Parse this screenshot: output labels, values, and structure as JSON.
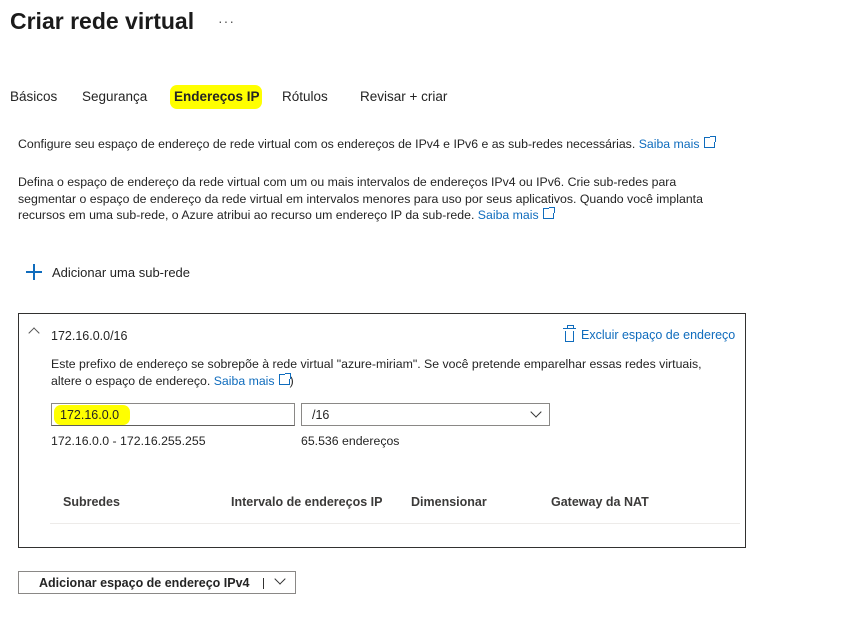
{
  "page": {
    "title": "Criar rede virtual",
    "more": "···"
  },
  "tabs": [
    {
      "label": "Básicos"
    },
    {
      "label": "Segurança"
    },
    {
      "label": "Endereços IP"
    },
    {
      "label": "Rótulos"
    },
    {
      "label": "Revisar + criar"
    }
  ],
  "intro": {
    "line1": "Configure seu espaço de endereço de rede virtual com os endereços de IPv4 e IPv6 e as sub-redes necessárias.",
    "line2_l1": "Defina o espaço de endereço da rede virtual com um ou mais intervalos de endereços IPv4 ou IPv6. Crie sub-redes para",
    "line2_l2": "segmentar o espaço de endereço da rede virtual em intervalos menores para uso por seus aplicativos. Quando você implanta",
    "line2_l3": "recursos em uma sub-rede, o Azure atribui ao recurso um endereço IP da sub-rede.",
    "learn_more": "Saiba mais"
  },
  "add_subnet": "Adicionar uma sub-rede",
  "address_space": {
    "cidr": "172.16.0.0/16",
    "delete_label": "Excluir espaço de endereço",
    "warning_l1": "Este prefixo de endereço se sobrepõe à rede virtual \"azure-miriam\". Se você pretende emparelhar essas redes virtuais,",
    "warning_l2": "altere o espaço de endereço.",
    "learn_more": "Saiba mais",
    "close_paren": ")",
    "address_value": "172.16.0.0",
    "prefix_value": "/16",
    "range": "172.16.0.0 - 172.16.255.255",
    "count": "65.536 endereços",
    "columns": [
      "Subredes",
      "Intervalo de endereços IP",
      "Dimensionar",
      "Gateway da NAT"
    ]
  },
  "add_space_button": "Adicionar espaço de endereço IPv4",
  "colors": {
    "highlight": "#ffff00",
    "link": "#0f6cbd"
  },
  "icons": [
    "ellipsis-icon",
    "plus-icon",
    "chevron-up-icon",
    "trash-icon",
    "chevron-down-icon",
    "external-link-icon"
  ]
}
